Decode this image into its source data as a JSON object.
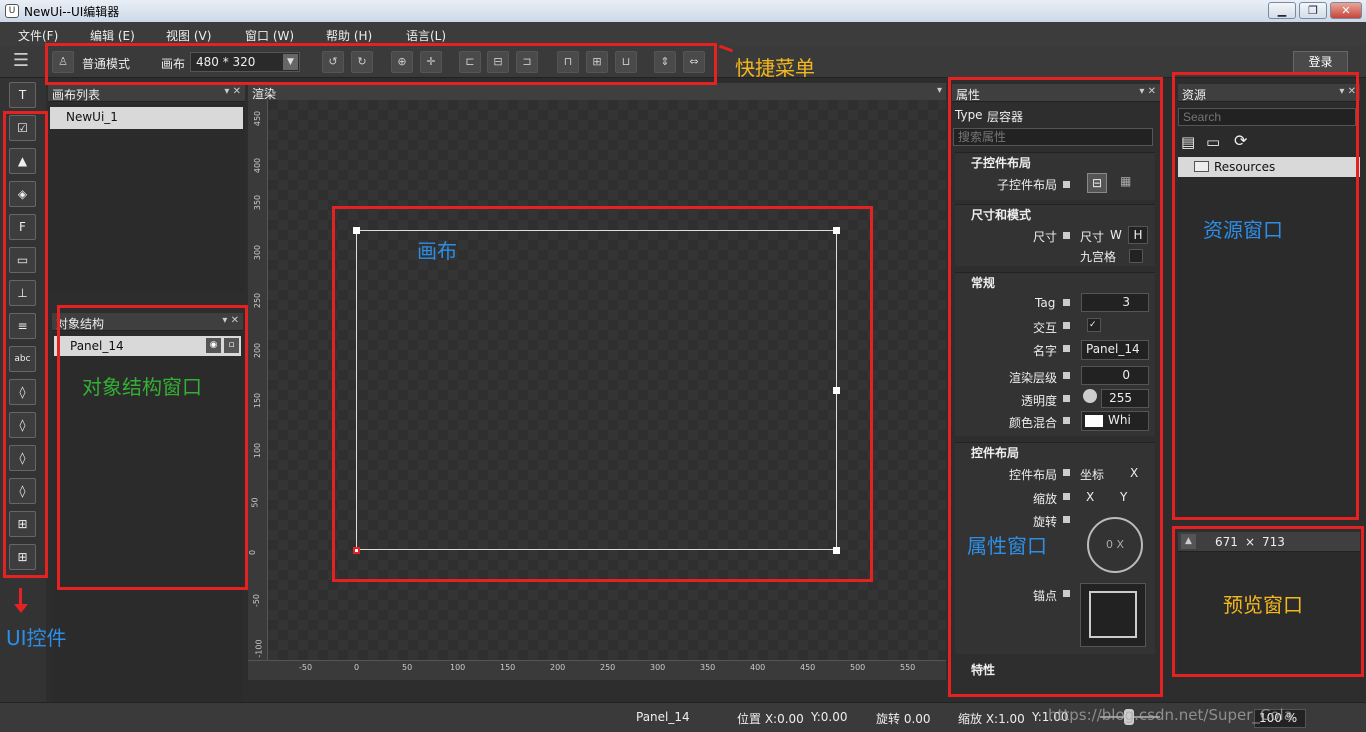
{
  "window": {
    "title": "NewUi--UI编辑器"
  },
  "menu": [
    "文件(F)",
    "编辑 (E)",
    "视图 (V)",
    "窗口 (W)",
    "帮助 (H)",
    "语言(L)"
  ],
  "toolbar": {
    "mode_label": "普通模式",
    "canvas_label": "画布",
    "canvas_size": "480 * 320",
    "login_label": "登录"
  },
  "panels": {
    "canvas_list": {
      "title": "画布列表",
      "items": [
        "NewUi_1"
      ]
    },
    "object_tree": {
      "title": "对象结构",
      "items": [
        "Panel_14"
      ]
    },
    "render": {
      "title": "渲染"
    },
    "properties": {
      "title": "属性",
      "type_label": "Type",
      "type_value": "层容器",
      "search_placeholder": "搜索属性"
    },
    "resources": {
      "title": "资源",
      "search_placeholder": "Search",
      "folder": "Resources"
    },
    "preview": {
      "size_w": "671",
      "size_x": "×",
      "size_h": "713"
    }
  },
  "props": {
    "child_layout_sec": "子控件布局",
    "child_layout": "子控件布局",
    "size_mode_sec": "尺寸和模式",
    "size": "尺寸",
    "size_sub": "尺寸",
    "w": "W",
    "h": "H",
    "nine": "九宫格",
    "general_sec": "常规",
    "tag": "Tag",
    "tag_value": "3",
    "interact": "交互",
    "name": "名字",
    "name_value": "Panel_14",
    "render_level": "渲染层级",
    "render_level_value": "0",
    "opacity": "透明度",
    "opacity_value": "255",
    "blend": "颜色混合",
    "blend_value": "Whi",
    "layout_sec": "控件布局",
    "layout": "控件布局",
    "coord": "坐标",
    "coord_x": "X",
    "scale": "缩放",
    "scale_x": "X",
    "scale_y": "Y",
    "rotate": "旋转",
    "rotate_value": "0 X",
    "anchor": "锚点",
    "feature_sec": "特性"
  },
  "ruler": {
    "h": [
      "-50",
      "0",
      "50",
      "100",
      "150",
      "200",
      "250",
      "300",
      "350",
      "400",
      "450",
      "500",
      "550"
    ],
    "v": [
      "450",
      "400",
      "350",
      "300",
      "250",
      "200",
      "150",
      "100",
      "50",
      "0",
      "-50",
      "-100"
    ]
  },
  "annotations": {
    "quick_menu": "快捷菜单",
    "canvas": "画布",
    "object_window": "对象结构窗口",
    "ui_controls": "UI控件",
    "property_window": "属性窗口",
    "resource_window": "资源窗口",
    "preview_window": "预览窗口"
  },
  "status": {
    "object": "Panel_14",
    "position": "位置 X:0.00",
    "pos_y": "Y:0.00",
    "rotation": "旋转 0.00",
    "scale": "缩放 X:1.00",
    "scale_y": "Y:1.00",
    "zoom": "100 %",
    "watermark": "https://blog.csdn.net/Super_Cola"
  },
  "colors": {
    "annotation_red": "#e42222",
    "annotation_yellow": "#f4b81d",
    "annotation_blue": "#2e8ee6",
    "annotation_green": "#33b033"
  }
}
